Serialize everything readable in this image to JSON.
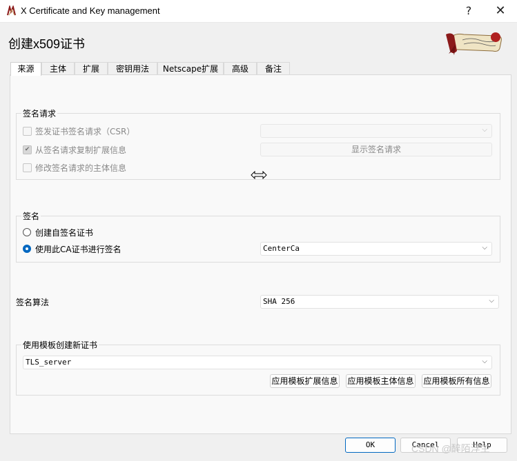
{
  "window": {
    "title": "X Certificate and Key management",
    "help": "?",
    "close": "✕"
  },
  "page": {
    "heading": "创建x509证书"
  },
  "tabs": [
    {
      "label": "来源",
      "active": true
    },
    {
      "label": "主体"
    },
    {
      "label": "扩展"
    },
    {
      "label": "密钥用法"
    },
    {
      "label": "Netscape扩展"
    },
    {
      "label": "高级"
    },
    {
      "label": "备注"
    }
  ],
  "signing_request": {
    "title": "签名请求",
    "options": [
      {
        "label": "签发证书签名请求（CSR）",
        "checked": false
      },
      {
        "label": "从签名请求复制扩展信息",
        "checked": true
      },
      {
        "label": "修改签名请求的主体信息",
        "checked": false
      }
    ],
    "csr_select_value": "",
    "show_request_button": "显示签名请求"
  },
  "signing": {
    "title": "签名",
    "self_signed_label": "创建自签名证书",
    "use_ca_label": "使用此CA证书进行签名",
    "ca_value": "CenterCa"
  },
  "algorithm": {
    "label": "签名算法",
    "value": "SHA 256"
  },
  "template": {
    "title": "使用模板创建新证书",
    "value": "TLS_server",
    "apply_extensions": "应用模板扩展信息",
    "apply_subject": "应用模板主体信息",
    "apply_all": "应用模板所有信息"
  },
  "footer": {
    "ok": "OK",
    "cancel": "Cancel",
    "help": "Help"
  },
  "watermark": "CSDN @醉陌浮生",
  "colors": {
    "accent": "#0067c0",
    "window": "#f0f0f0",
    "pane": "#f9f9f9"
  }
}
